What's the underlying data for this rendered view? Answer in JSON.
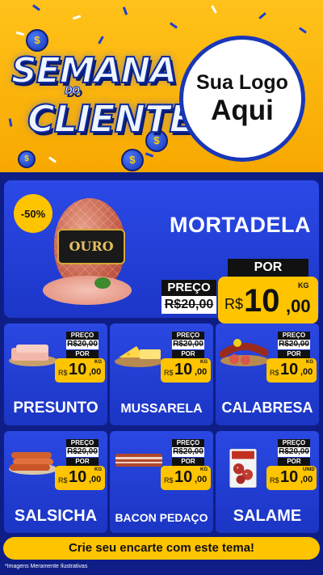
{
  "header": {
    "title_line1": "SEMANA",
    "title_line2": "DO",
    "title_line3": "CLIENTE",
    "logo_line1": "Sua Logo",
    "logo_line2": "Aqui"
  },
  "featured": {
    "discount": "-50%",
    "brand": "OURO",
    "name": "MORTADELA",
    "old_label": "PREÇO",
    "old_price": "R$20,00",
    "new_label": "POR",
    "currency": "R$",
    "price_int": "10",
    "price_cents": ",00",
    "unit": "KG"
  },
  "products": [
    {
      "name": "PRESUNTO",
      "old_label": "PREÇO",
      "old_price": "R$20,00",
      "new_label": "POR",
      "currency": "R$",
      "price_int": "10",
      "price_cents": ",00",
      "unit": "KG"
    },
    {
      "name": "MUSSARELA",
      "old_label": "PREÇO",
      "old_price": "R$20,00",
      "new_label": "POR",
      "currency": "R$",
      "price_int": "10",
      "price_cents": ",00",
      "unit": "KG"
    },
    {
      "name": "CALABRESA",
      "old_label": "PREÇO",
      "old_price": "R$20,00",
      "new_label": "POR",
      "currency": "R$",
      "price_int": "10",
      "price_cents": ",00",
      "unit": "KG"
    },
    {
      "name": "SALSICHA",
      "old_label": "PREÇO",
      "old_price": "R$20,00",
      "new_label": "POR",
      "currency": "R$",
      "price_int": "10",
      "price_cents": ",00",
      "unit": "KG"
    },
    {
      "name": "BACON PEDAÇO",
      "old_label": "PREÇO",
      "old_price": "R$20,00",
      "new_label": "POR",
      "currency": "R$",
      "price_int": "10",
      "price_cents": ",00",
      "unit": "KG"
    },
    {
      "name": "SALAME",
      "old_label": "PREÇO",
      "old_price": "R$20,00",
      "new_label": "POR",
      "currency": "R$",
      "price_int": "10",
      "price_cents": ",00",
      "unit": "UNID"
    }
  ],
  "cta": "Crie seu encarte com este tema!",
  "footnote": "*Imagens Meramente Ilustrativas",
  "colors": {
    "header_bg": "#ffc21a",
    "panel_bg": "#2b49e6",
    "page_bg": "#10208c",
    "price_bg": "#ffc400"
  }
}
